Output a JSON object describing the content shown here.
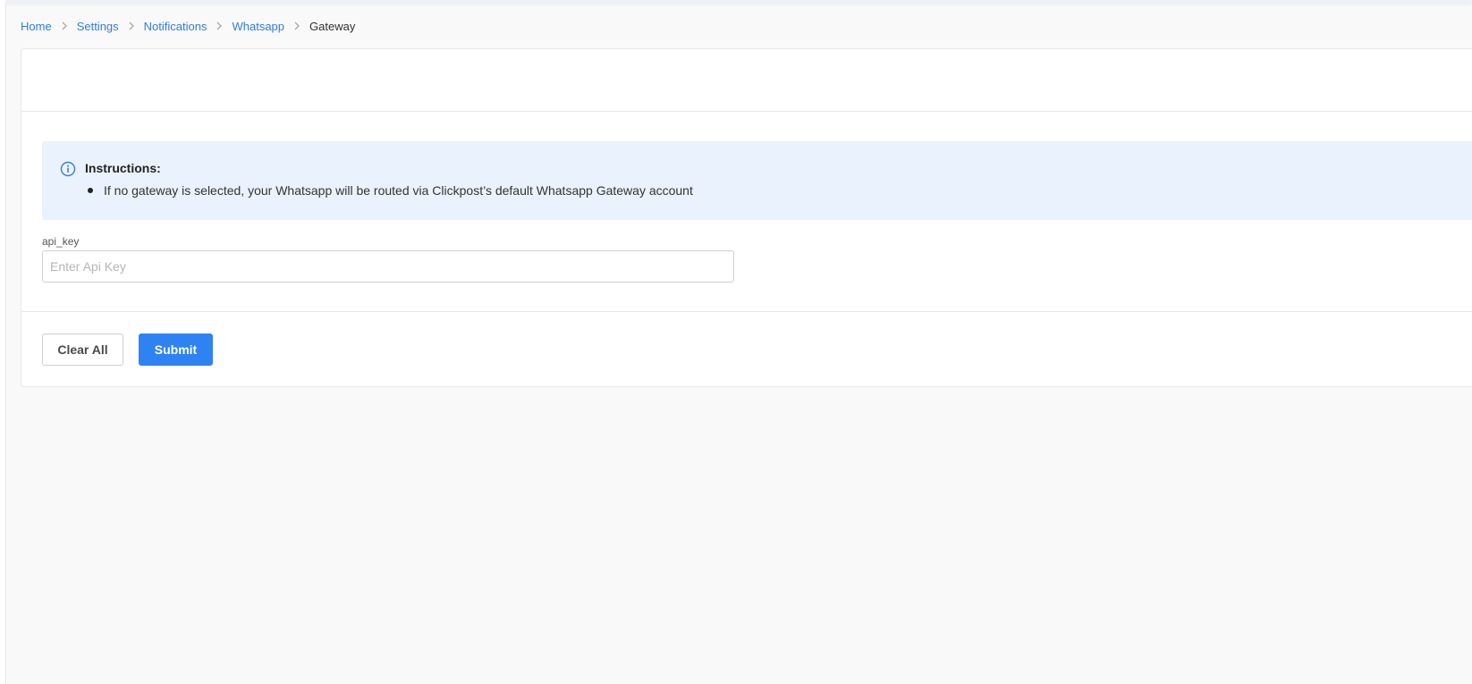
{
  "breadcrumb": {
    "items": [
      {
        "label": "Home"
      },
      {
        "label": "Settings"
      },
      {
        "label": "Notifications"
      },
      {
        "label": "Whatsapp"
      },
      {
        "label": "Gateway"
      }
    ]
  },
  "instructions": {
    "title": "Instructions:",
    "items": [
      "If no gateway is selected, your Whatsapp will be routed via Clickpost’s default Whatsapp Gateway account"
    ]
  },
  "form": {
    "api_key": {
      "label": "api_key",
      "placeholder": "Enter Api Key",
      "value": ""
    }
  },
  "actions": {
    "clear_label": "Clear All",
    "submit_label": "Submit"
  },
  "colors": {
    "link": "#2f7de1",
    "primary_button": "#2f82f1",
    "info_background": "#eaf2fd",
    "page_background": "#f9f9f9"
  }
}
